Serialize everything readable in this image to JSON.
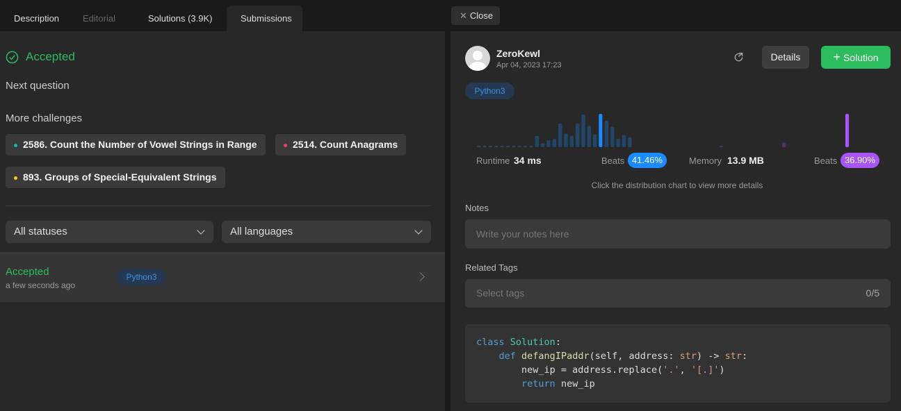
{
  "tabs": [
    {
      "label": "Description"
    },
    {
      "label": "Editorial"
    },
    {
      "label": "Solutions (3.9K)"
    },
    {
      "label": "Submissions"
    }
  ],
  "close_label": "Close",
  "left": {
    "status": "Accepted",
    "next_question": "Next question",
    "more_challenges": "More challenges",
    "challenges": [
      {
        "label": "2586. Count the Number of Vowel Strings in Range",
        "difficulty_color": "#1cb8a3"
      },
      {
        "label": "2514. Count Anagrams",
        "difficulty_color": "#f63f62"
      },
      {
        "label": "893. Groups of Special-Equivalent Strings",
        "difficulty_color": "#ffc01e"
      }
    ],
    "filters": {
      "status": "All statuses",
      "language": "All languages"
    },
    "submissions": [
      {
        "status": "Accepted",
        "time": "a few seconds ago",
        "language": "Python3"
      }
    ]
  },
  "right": {
    "username": "ZeroKewl",
    "date": "Apr 04, 2023 17:23",
    "details_label": "Details",
    "solution_label": "Solution",
    "language": "Python3",
    "runtime_label": "Runtime",
    "runtime_value": "34 ms",
    "beats_label": "Beats",
    "runtime_beats": "41.46%",
    "memory_label": "Memory",
    "memory_value": "13.9 MB",
    "memory_beats": "36.90%",
    "chart_hint": "Click the distribution chart to view more details",
    "notes_label": "Notes",
    "notes_placeholder": "Write your notes here",
    "tags_label": "Related Tags",
    "tags_placeholder": "Select tags",
    "tags_count": "0/5"
  },
  "chart_data": [
    {
      "type": "bar",
      "title": "Runtime distribution",
      "values": [
        1,
        1,
        1,
        1,
        1,
        1,
        1,
        1,
        1,
        1,
        15,
        5,
        9,
        11,
        31,
        18,
        15,
        31,
        43,
        28,
        17,
        44,
        35,
        27,
        11,
        16,
        13
      ],
      "highlight_index": 21,
      "color": "#1a8cff"
    },
    {
      "type": "bar",
      "title": "Memory distribution",
      "values": [
        1,
        6,
        44
      ],
      "highlight_index": 2,
      "color": "#a855f7"
    }
  ],
  "colors": {
    "accent_green": "#2cbb5d",
    "blue": "#1a8cff",
    "purple": "#a855f7"
  }
}
